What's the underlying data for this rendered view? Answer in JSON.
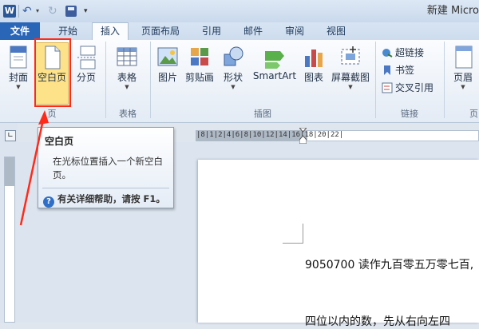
{
  "window": {
    "title": "新建 Micro"
  },
  "quick_access": {
    "app_icon": "W"
  },
  "tabs": [
    {
      "label": "文件"
    },
    {
      "label": "开始"
    },
    {
      "label": "插入"
    },
    {
      "label": "页面布局"
    },
    {
      "label": "引用"
    },
    {
      "label": "邮件"
    },
    {
      "label": "审阅"
    },
    {
      "label": "视图"
    }
  ],
  "ribbon": {
    "pages": {
      "cover": "封面",
      "blank": "空白页",
      "break": "分页",
      "group": "页"
    },
    "tables": {
      "table": "表格",
      "group": "表格"
    },
    "illustrations": {
      "picture": "图片",
      "clipart": "剪贴画",
      "shapes": "形状",
      "smartart": "SmartArt",
      "chart": "图表",
      "screenshot": "屏幕截图",
      "group": "插图"
    },
    "links": {
      "hyperlink": "超链接",
      "bookmark": "书签",
      "crossref": "交叉引用",
      "group": "链接"
    },
    "header_footer": {
      "header": "页眉",
      "group": "页"
    }
  },
  "ruler": {
    "ticks": "|8|1|2|4|6|8|10|12|14|16|18|20|22|"
  },
  "tooltip": {
    "title": "空白页",
    "body": "在光标位置插入一个新空白页。",
    "help": "有关详细帮助，请按 F1。",
    "help_icon": "?"
  },
  "document": {
    "line1": "9050700 读作九百零五万零七百,",
    "line2": "四位以内的数，先从右向左四"
  },
  "colors": {
    "highlight": "#fde289",
    "annotation": "#ff2a1a",
    "file_tab": "#2a66b8"
  }
}
